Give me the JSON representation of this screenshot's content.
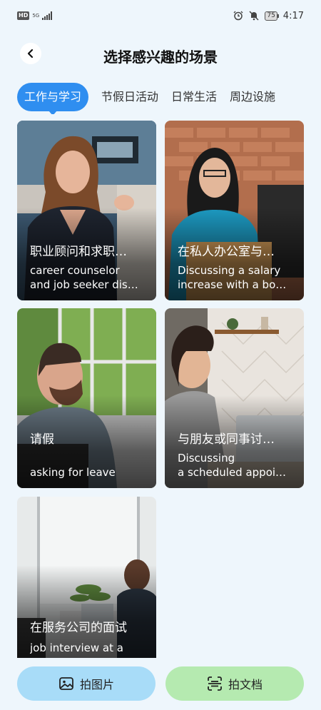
{
  "status": {
    "hd": "HD",
    "network": "5G",
    "battery": "75",
    "time": "4:17"
  },
  "header": {
    "title": "选择感兴趣的场景",
    "back_glyph": "‹"
  },
  "tabs": [
    {
      "label": "工作与学习",
      "active": true
    },
    {
      "label": "节假日活动",
      "active": false
    },
    {
      "label": "日常生活",
      "active": false
    },
    {
      "label": "周边设施",
      "active": false
    }
  ],
  "cards": [
    {
      "zh": "职业顾问和求职…",
      "en1": "career counselor",
      "en2": "and job seeker dis…",
      "icon": "person-photo"
    },
    {
      "zh": "在私人办公室与…",
      "en1": "Discussing a salary",
      "en2": "increase with a bo…",
      "icon": "person-photo"
    },
    {
      "zh": "请假",
      "en1": "asking for leave",
      "en2": "",
      "icon": "person-photo"
    },
    {
      "zh": "与朋友或同事讨…",
      "en1": "Discussing",
      "en2": "a scheduled appoi…",
      "icon": "person-photo"
    },
    {
      "zh": "在服务公司的面试",
      "en1": "job interview at a",
      "en2": "",
      "icon": "person-photo"
    }
  ],
  "bottom": {
    "photo_label": "拍图片",
    "doc_label": "拍文档",
    "photo_icon": "image-icon",
    "doc_icon": "scan-doc-icon"
  },
  "colors": {
    "accent": "#2f8ef0",
    "background": "#eef6fc",
    "photo_button": "#a8dcf8",
    "doc_button": "#b5eab0"
  }
}
